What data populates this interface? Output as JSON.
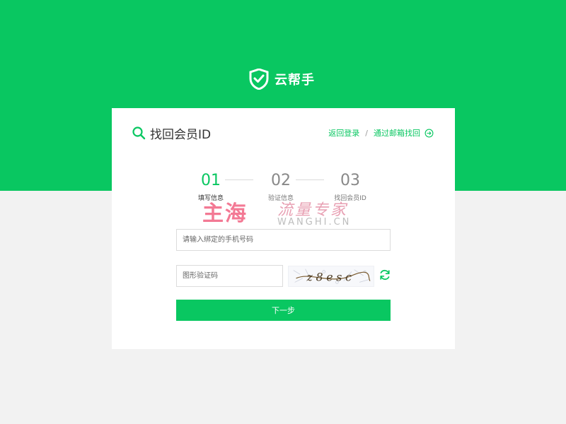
{
  "colors": {
    "brand_green": "#09c761",
    "page_bg": "#f2f2f2",
    "watermark_pink": "#f26b89"
  },
  "header": {
    "brand_name": "云帮手",
    "logo_icon": "shield-check-icon"
  },
  "card": {
    "title": "找回会员ID",
    "title_icon": "search-icon",
    "links": {
      "back_login": "返回登录",
      "separator": "/",
      "email_recover": "通过邮箱找回",
      "arrow_icon": "arrow-right-circle-icon"
    }
  },
  "steps": [
    {
      "number": "01",
      "label": "填写信息",
      "active": true
    },
    {
      "number": "02",
      "label": "验证信息",
      "active": false
    },
    {
      "number": "03",
      "label": "找回会员ID",
      "active": false
    }
  ],
  "watermark": {
    "main": "主海",
    "sub": "流量专家",
    "en": "WANGHI.CN"
  },
  "form": {
    "phone_placeholder": "请输入绑定的手机号码",
    "captcha_placeholder": "图形验证码",
    "captcha_text": "z8esc",
    "refresh_icon": "refresh-icon",
    "submit_label": "下一步"
  }
}
